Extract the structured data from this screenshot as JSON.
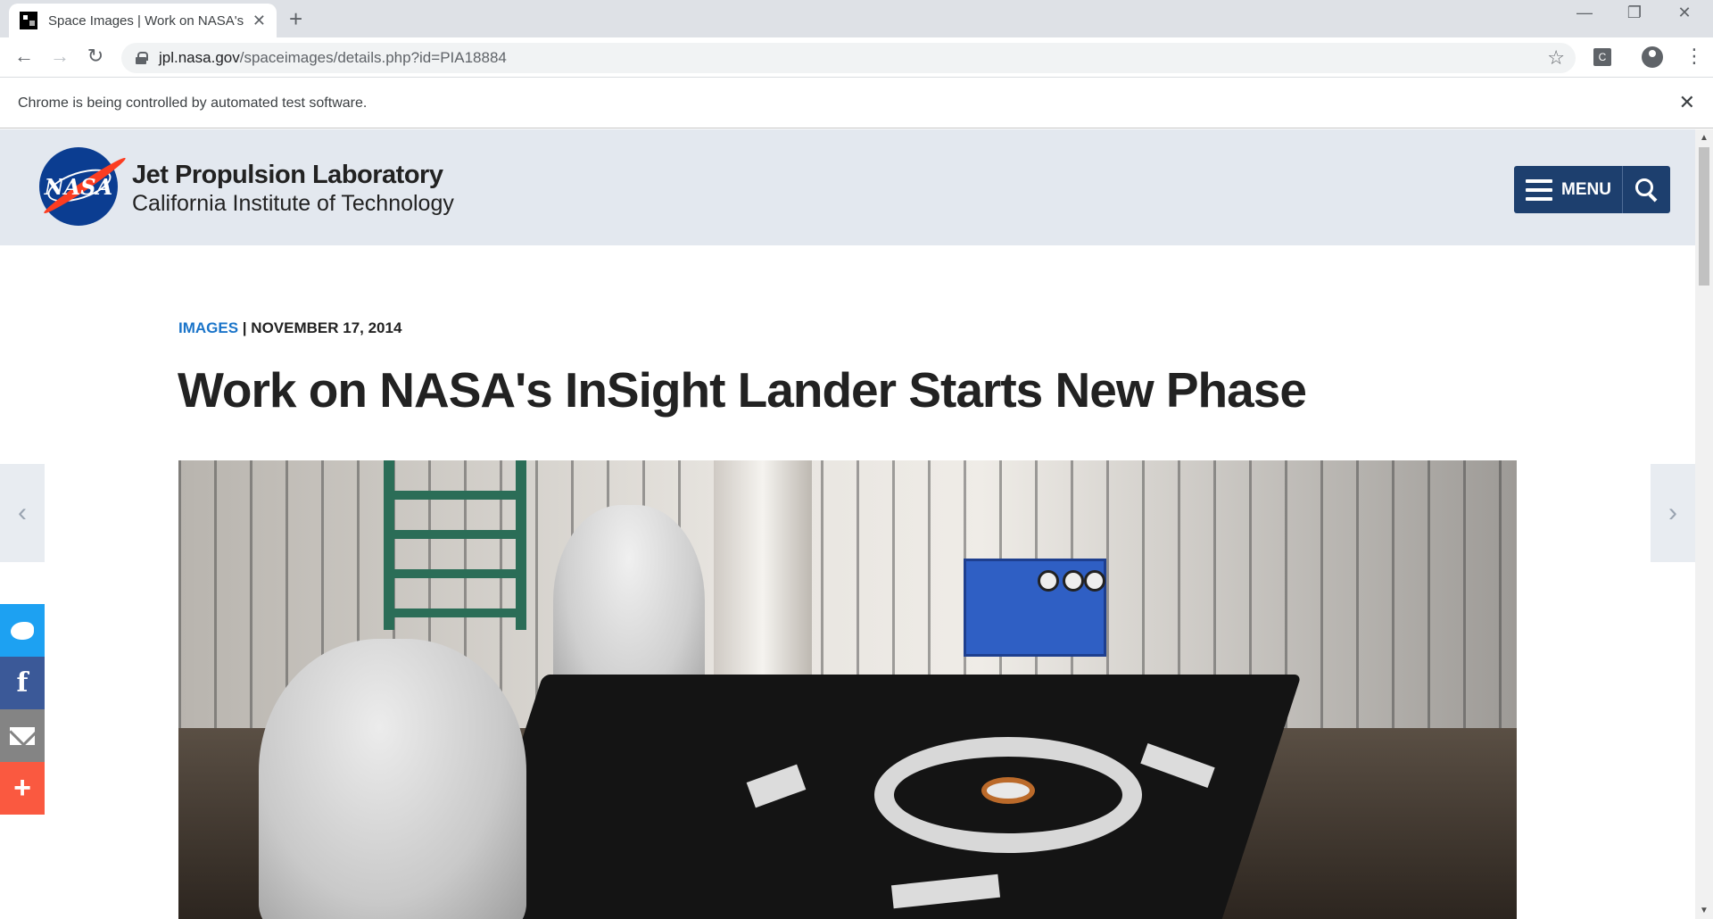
{
  "browser": {
    "tab_title": "Space Images | Work on NASA's",
    "tab_close": "✕",
    "new_tab": "+",
    "window_controls": {
      "minimize": "—",
      "restore": "❐",
      "close": "✕"
    },
    "nav": {
      "back": "←",
      "forward": "→",
      "reload": "↻"
    },
    "url_host": "jpl.nasa.gov",
    "url_path": "/spaceimages/details.php?id=PIA18884",
    "star": "☆",
    "extension": "C",
    "menu": "⋮",
    "infobar_text": "Chrome is being controlled by automated test software.",
    "infobar_close": "✕"
  },
  "header": {
    "logo_text": "NASA",
    "title": "Jet Propulsion Laboratory",
    "subtitle": "California Institute of Technology",
    "menu_label": "MENU"
  },
  "article": {
    "category": "IMAGES",
    "separator": "|",
    "date": "NOVEMBER 17, 2014",
    "title": "Work on NASA's InSight Lander Starts New Phase"
  },
  "carousel": {
    "prev": "‹",
    "next": "›"
  },
  "share": {
    "facebook": "f",
    "more": "+"
  },
  "scrollbar": {
    "up": "▲",
    "down": "▼"
  }
}
